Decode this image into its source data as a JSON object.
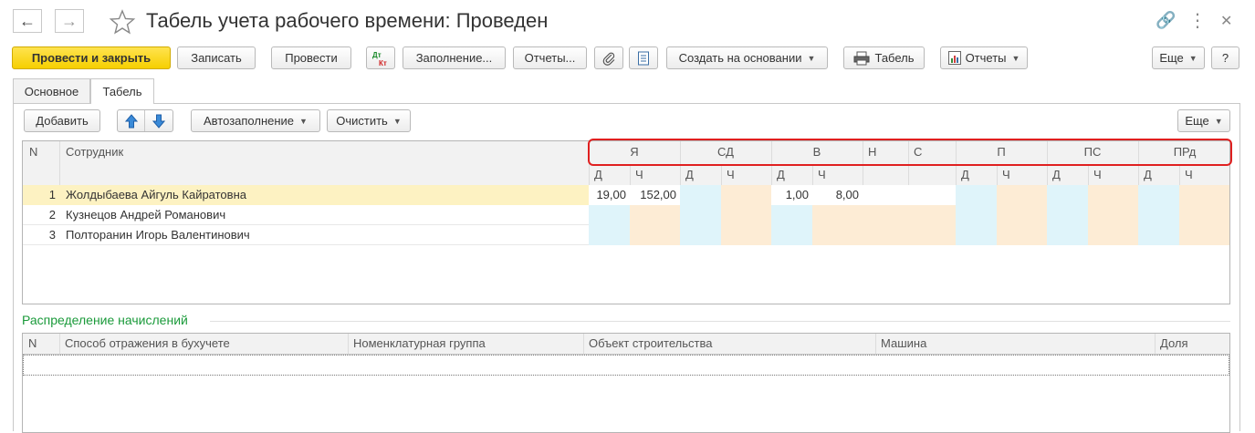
{
  "window": {
    "title": "Табель учета рабочего времени: Проведен"
  },
  "toolbar": {
    "post_close": "Провести и закрыть",
    "save": "Записать",
    "post": "Провести",
    "fill": "Заполнение...",
    "reports_dots": "Отчеты...",
    "create_based": "Создать на основании",
    "timesheet": "Табель",
    "reports": "Отчеты",
    "more": "Еще",
    "help": "?"
  },
  "tabs": [
    "Основное",
    "Табель"
  ],
  "table_toolbar": {
    "add": "Добавить",
    "autofill": "Автозаполнение",
    "clear": "Очистить",
    "more": "Еще"
  },
  "table": {
    "col_n": "N",
    "col_employee": "Сотрудник",
    "groups": [
      "Я",
      "СД",
      "В",
      "Н",
      "С",
      "П",
      "ПС",
      "ПРд"
    ],
    "sub_d": "Д",
    "sub_ch": "Ч",
    "rows": [
      {
        "n": "1",
        "name": "Жолдыбаева Айгуль Кайратовна",
        "ya_d": "19,00",
        "ya_ch": "152,00",
        "v_d": "1,00",
        "v_ch": "8,00"
      },
      {
        "n": "2",
        "name": "Кузнецов Андрей Романович",
        "ya_d": "",
        "ya_ch": "",
        "v_d": "",
        "v_ch": ""
      },
      {
        "n": "3",
        "name": "Полторанин Игорь Валентинович",
        "ya_d": "",
        "ya_ch": "",
        "v_d": "",
        "v_ch": ""
      }
    ]
  },
  "distribution": {
    "title": "Распределение начислений",
    "columns": [
      "N",
      "Способ отражения в бухучете",
      "Номенклатурная группа",
      "Объект строительства",
      "Машина",
      "Доля"
    ]
  },
  "colors": {
    "selected_row": "#fdf2c2",
    "cyan_cell": "#dff4fa",
    "peach_cell": "#fdecd5",
    "section_green": "#1a9a3a"
  }
}
